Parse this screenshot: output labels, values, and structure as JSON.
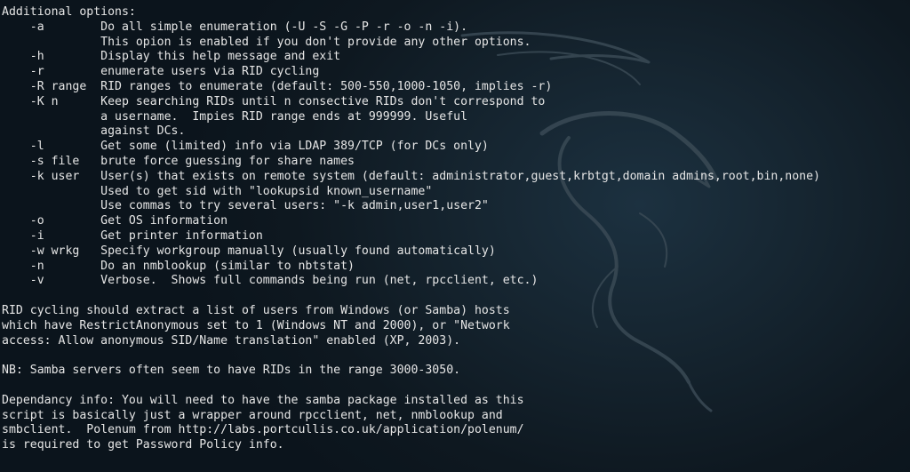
{
  "terminal": {
    "lines": [
      "Additional options:",
      "    -a        Do all simple enumeration (-U -S -G -P -r -o -n -i).",
      "              This opion is enabled if you don't provide any other options.",
      "    -h        Display this help message and exit",
      "    -r        enumerate users via RID cycling",
      "    -R range  RID ranges to enumerate (default: 500-550,1000-1050, implies -r)",
      "    -K n      Keep searching RIDs until n consective RIDs don't correspond to",
      "              a username.  Impies RID range ends at 999999. Useful",
      "              against DCs.",
      "    -l        Get some (limited) info via LDAP 389/TCP (for DCs only)",
      "    -s file   brute force guessing for share names",
      "    -k user   User(s) that exists on remote system (default: administrator,guest,krbtgt,domain admins,root,bin,none)",
      "              Used to get sid with \"lookupsid known_username\"",
      "              Use commas to try several users: \"-k admin,user1,user2\"",
      "    -o        Get OS information",
      "    -i        Get printer information",
      "    -w wrkg   Specify workgroup manually (usually found automatically)",
      "    -n        Do an nmblookup (similar to nbtstat)",
      "    -v        Verbose.  Shows full commands being run (net, rpcclient, etc.)",
      "",
      "RID cycling should extract a list of users from Windows (or Samba) hosts",
      "which have RestrictAnonymous set to 1 (Windows NT and 2000), or \"Network",
      "access: Allow anonymous SID/Name translation\" enabled (XP, 2003).",
      "",
      "NB: Samba servers often seem to have RIDs in the range 3000-3050.",
      "",
      "Dependancy info: You will need to have the samba package installed as this",
      "script is basically just a wrapper around rpcclient, net, nmblookup and",
      "smbclient.  Polenum from http://labs.portcullis.co.uk/application/polenum/",
      "is required to get Password Policy info."
    ]
  },
  "colors": {
    "background": "#0b141c",
    "text": "#e6e6e6",
    "watermark": "#3a4a55"
  }
}
